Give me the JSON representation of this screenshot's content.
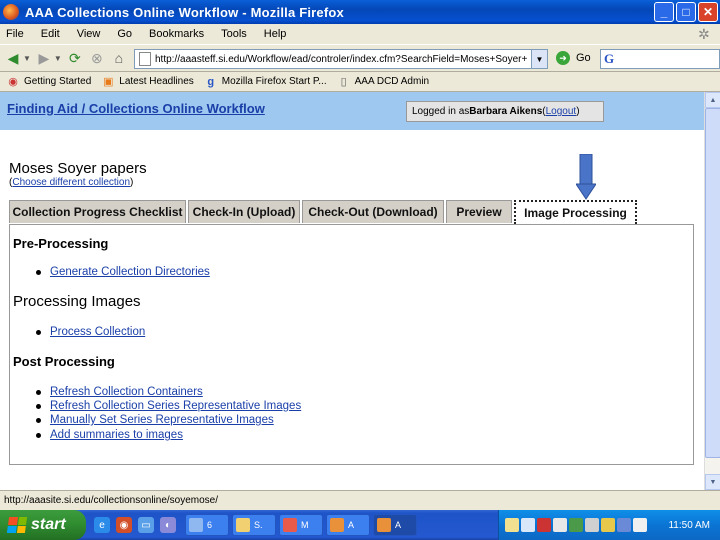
{
  "window": {
    "title": "AAA Collections Online Workflow - Mozilla Firefox",
    "minimize_glyph": "_",
    "maximize_glyph": "□",
    "close_glyph": "✕"
  },
  "menu": [
    "File",
    "Edit",
    "View",
    "Go",
    "Bookmarks",
    "Tools",
    "Help"
  ],
  "navigation": {
    "url": "http://aaasteff.si.edu/Workflow/ead/controler/index.cfm?SearchField=Moses+Soyer+",
    "go_label": "Go",
    "search_logo": "G"
  },
  "bookmarks": [
    {
      "label": "Getting Started",
      "icon": "firefox-icon"
    },
    {
      "label": "Latest Headlines",
      "icon": "rss-icon"
    },
    {
      "label": "Mozilla Firefox Start P...",
      "icon": "google-icon"
    },
    {
      "label": "AAA DCD Admin",
      "icon": "page-icon"
    }
  ],
  "page": {
    "app_title": "Finding Aid / Collections Online Workflow",
    "login_prefix": "Logged in as ",
    "login_user": "Barbara Aikens",
    "logout_open": " (",
    "logout_label": "Logout",
    "logout_close": ")",
    "collection_title": "Moses Soyer papers",
    "change_open": "(",
    "change_link": "Choose different collection",
    "change_close": ")"
  },
  "tabs": [
    {
      "label": "Collection Progress Checklist",
      "active": false
    },
    {
      "label": "Check-In (Upload)",
      "active": false
    },
    {
      "label": "Check-Out (Download)",
      "active": false
    },
    {
      "label": "Preview",
      "active": false
    },
    {
      "label": "Image Processing",
      "active": true
    }
  ],
  "sections": {
    "pre": {
      "heading": "Pre-Processing",
      "links": [
        "Generate Collection Directories"
      ]
    },
    "processing": {
      "heading": "Processing Images",
      "links": [
        "Process Collection"
      ]
    },
    "post": {
      "heading": "Post Processing",
      "links": [
        "Refresh Collection Containers",
        "Refresh Collection Series Representative Images",
        "Manually Set Series Representative Images",
        "Add summaries to images"
      ]
    }
  },
  "status_bar": "http://aaasite.si.edu/collectionsonline/soyemose/",
  "taskbar": {
    "start_label": "start",
    "tasks": [
      {
        "label": "6",
        "icon": "windows-icon"
      },
      {
        "label": "S.",
        "icon": "folder-icon"
      },
      {
        "label": "M",
        "icon": "mail-icon"
      },
      {
        "label": "A",
        "icon": "firefox-icon"
      },
      {
        "label": "A",
        "icon": "firefox-icon"
      }
    ],
    "clock": "11:50 AM"
  },
  "colors": {
    "header_band": "#9ec8f0",
    "link": "#1a3fa8",
    "arrow": "#4a74c8"
  }
}
